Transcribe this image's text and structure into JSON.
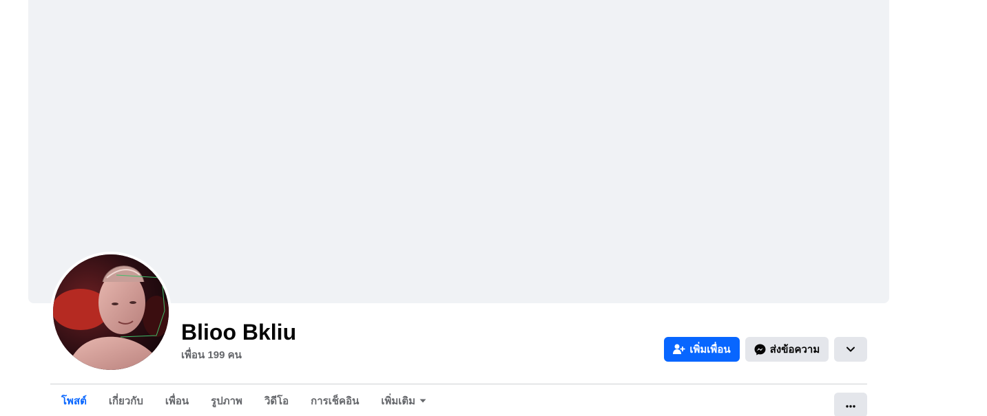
{
  "profile": {
    "name": "Blioo Bkliu",
    "friends_text": "เพื่อน 199 คน"
  },
  "actions": {
    "add_friend_label": "เพิ่มเพื่อน",
    "add_friend_icon": "person-add-icon",
    "message_label": "ส่งข้อความ",
    "message_icon": "messenger-icon",
    "more_icon": "chevron-down-icon"
  },
  "tabs": [
    {
      "label": "โพสต์",
      "active": true
    },
    {
      "label": "เกี่ยวกับ",
      "active": false
    },
    {
      "label": "เพื่อน",
      "active": false
    },
    {
      "label": "รูปภาพ",
      "active": false
    },
    {
      "label": "วิดีโอ",
      "active": false
    },
    {
      "label": "การเช็คอิน",
      "active": false
    },
    {
      "label": "เพิ่มเติม",
      "active": false
    }
  ],
  "tabs_more_icon": "ellipsis-icon",
  "colors": {
    "accent": "#0866ff",
    "cover_background": "#f0f2f5",
    "button_secondary": "#e4e6eb",
    "text_primary": "#050505",
    "text_secondary": "#65676b"
  }
}
